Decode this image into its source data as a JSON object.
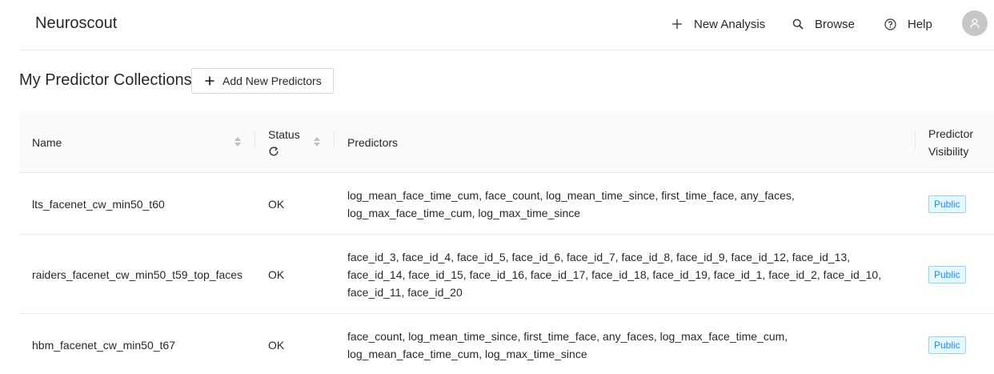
{
  "navbar": {
    "brand": "Neuroscout",
    "items": [
      {
        "label": "New Analysis",
        "icon": "plus-icon"
      },
      {
        "label": "Browse",
        "icon": "search-icon"
      },
      {
        "label": "Help",
        "icon": "question-circle-icon"
      }
    ],
    "avatar_icon": "user-icon"
  },
  "page": {
    "title": "My Predictor Collections",
    "add_button_label": "Add New Predictors"
  },
  "table": {
    "columns": [
      {
        "label": "Name"
      },
      {
        "label": "Status"
      },
      {
        "label": "Predictors"
      },
      {
        "label_line1": "Predictor",
        "label_line2": "Visibility"
      }
    ],
    "rows": [
      {
        "name": "lts_facenet_cw_min50_t60",
        "status": "OK",
        "predictors": "log_mean_face_time_cum, face_count, log_mean_time_since, first_time_face, any_faces, log_max_face_time_cum, log_max_time_since",
        "visibility": "Public"
      },
      {
        "name": "raiders_facenet_cw_min50_t59_top_faces",
        "status": "OK",
        "predictors": "face_id_3, face_id_4, face_id_5, face_id_6, face_id_7, face_id_8, face_id_9, face_id_12, face_id_13, face_id_14, face_id_15, face_id_16, face_id_17, face_id_18, face_id_19, face_id_1, face_id_2, face_id_10, face_id_11, face_id_20",
        "visibility": "Public"
      },
      {
        "name": "hbm_facenet_cw_min50_t67",
        "status": "OK",
        "predictors": "face_count, log_mean_time_since, first_time_face, any_faces, log_max_face_time_cum, log_mean_face_time_cum, log_max_time_since",
        "visibility": "Public"
      }
    ]
  },
  "colors": {
    "badge_text": "#1890ff",
    "badge_bg": "#e6f7ff",
    "badge_border": "#91d5ff",
    "header_bg": "#fafafa"
  }
}
